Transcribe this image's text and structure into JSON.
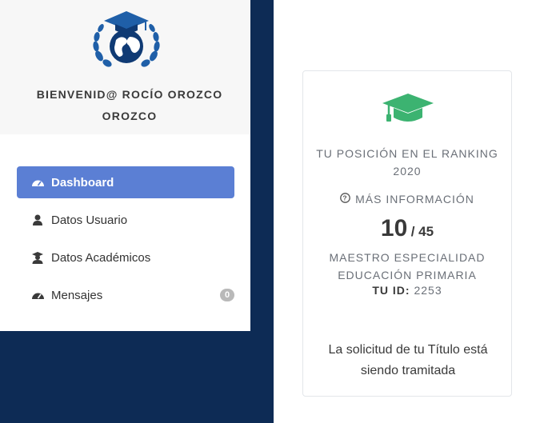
{
  "colors": {
    "navy": "#0d2b55",
    "accent": "#5b7fd4",
    "green": "#3cb371"
  },
  "sidebar": {
    "welcome": "BIENVENID@ ROCÍO OROZCO OROZCO",
    "logo_icon": "graduation-globe-laurel-logo",
    "items": [
      {
        "label": "Dashboard",
        "icon": "dashboard-icon",
        "active": true
      },
      {
        "label": "Datos Usuario",
        "icon": "user-icon",
        "active": false
      },
      {
        "label": "Datos Académicos",
        "icon": "graduate-user-icon",
        "active": false
      },
      {
        "label": "Mensajes",
        "icon": "messages-icon",
        "active": false,
        "badge": "0"
      }
    ]
  },
  "card": {
    "icon": "graduation-cap-icon",
    "rank_label": "TU POSICIÓN EN EL RANKING 2020",
    "more_info": "MÁS INFORMACIÓN",
    "position": "10",
    "total": "/ 45",
    "degree": "MAESTRO ESPECIALIDAD EDUCACIÓN PRIMARIA",
    "id_label": "TU ID:",
    "id_value": "2253",
    "status": "La solicitud de tu Título está siendo tramitada"
  }
}
